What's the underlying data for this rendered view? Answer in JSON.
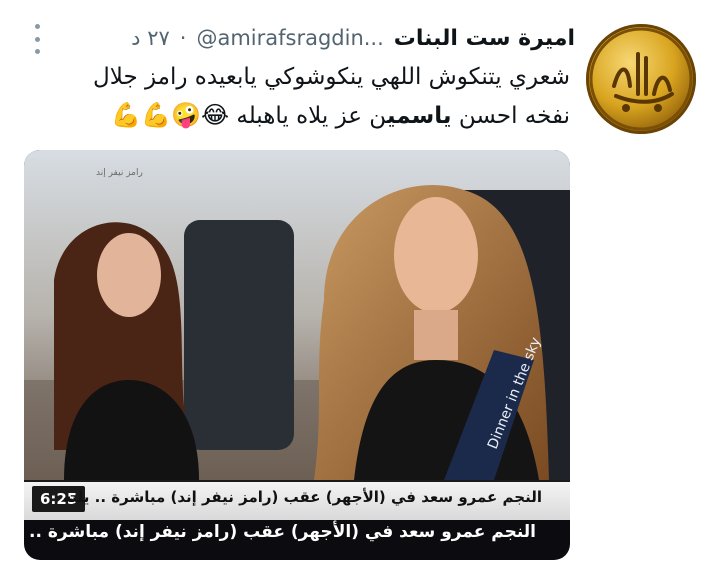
{
  "tweet": {
    "display_name": "اميرة ست البنات",
    "handle": "@amirafsragdin...",
    "separator": "·",
    "time": "٢٧ د",
    "line1": "شعري يتنكوش اللهي ينكوشوكي يابعيده رامز جلال",
    "line2_start": "نفخه احسن ",
    "line2_bold": "ياسمي",
    "line2_end": "ن عز يلاه ياهبله ",
    "emojis": "😂🤪💪💪"
  },
  "media": {
    "ticker_text": "النجم عمرو سعد في (الأجهر) عقب (رامز نيفر إند) مباشرة .. يليه",
    "clock": "6:25",
    "headline": "النجم عمرو سعد في (الأجهر) عقب (رامز نيفر إند) مباشرة .. يليه",
    "watermark": "رامز نيفر إند",
    "seat_text": "Dinner in the sky"
  },
  "icons": {
    "avatar": "golden-calligraphy-avatar",
    "more": "more-vertical-icon"
  },
  "colors": {
    "text": "#0f1419",
    "secondary": "#536471"
  }
}
